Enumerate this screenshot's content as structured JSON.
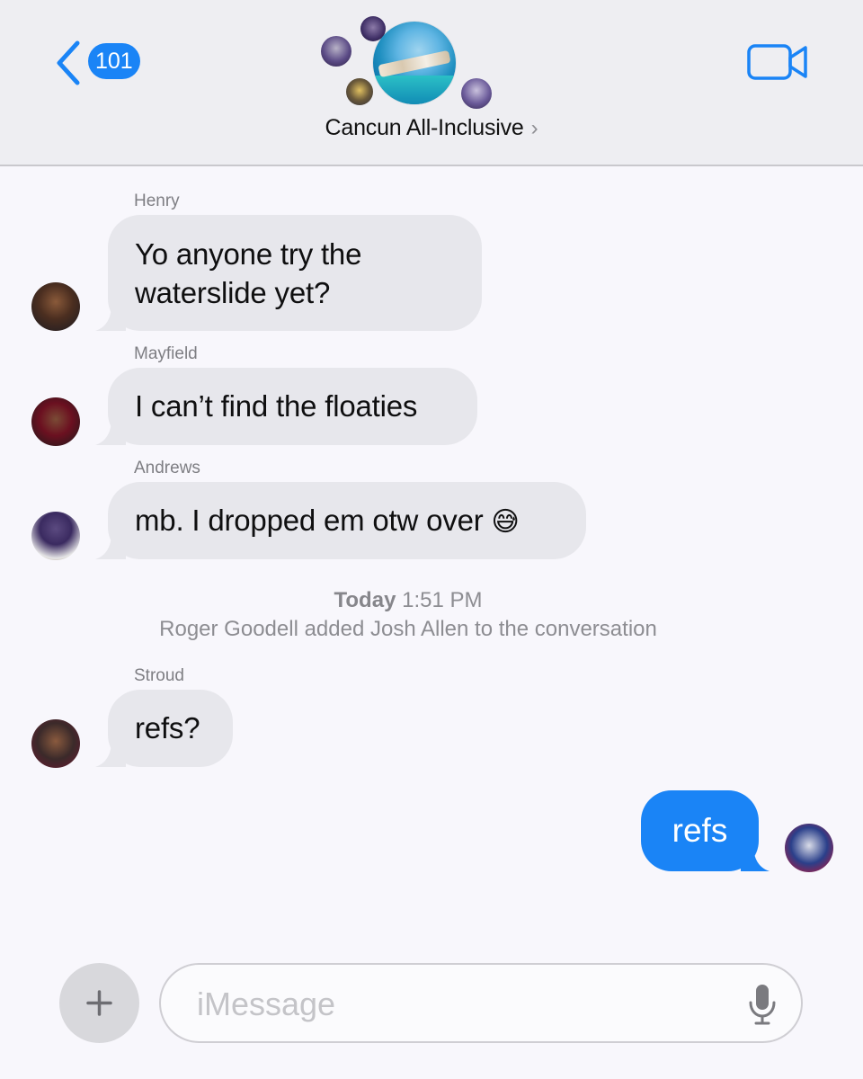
{
  "header": {
    "back_count": "101",
    "group_name": "Cancun All-Inclusive",
    "chevron": "›",
    "icons": {
      "back": "chevron-left-icon",
      "video": "video-camera-icon"
    }
  },
  "messages": [
    {
      "sender": "Henry",
      "lines": [
        "Yo anyone try the",
        "waterslide yet?"
      ]
    },
    {
      "sender": "Mayfield",
      "text": "I can’t find the floaties"
    },
    {
      "sender": "Andrews",
      "text": "mb. I dropped em otw over",
      "emoji": "😅"
    },
    {
      "sender": "Stroud",
      "text": "refs?"
    }
  ],
  "status": {
    "day": "Today",
    "time": "1:51 PM",
    "event": "Roger Goodell added Josh Allen to the conversation"
  },
  "outgoing": {
    "text": "refs"
  },
  "composer": {
    "placeholder": "iMessage",
    "icons": {
      "plus": "plus-icon",
      "mic": "microphone-icon"
    }
  },
  "colors": {
    "accent": "#1a84f6",
    "incoming_bubble": "#e7e7ec",
    "background": "#f8f7fc"
  }
}
